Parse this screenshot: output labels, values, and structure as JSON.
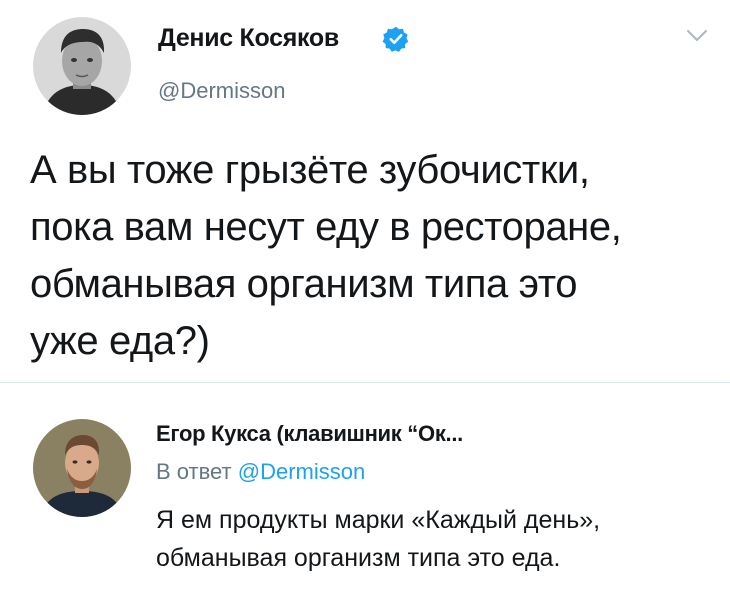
{
  "tweet": {
    "author_name": "Денис Косяков",
    "author_handle": "@Dermisson",
    "text": "А вы тоже грызёте зубочистки,\nпока вам несут еду в ресторане,\nобманывая организм типа это\nуже еда?)",
    "verified": true
  },
  "reply": {
    "author_name": "Егор Кукса (клавишник “Ок...",
    "reply_prefix": "В ответ",
    "reply_handle": "@Dermisson",
    "text": "Я ем продукты марки «Каждый день»,\nобманывая организм типа это еда."
  },
  "colors": {
    "verified_badge": "#1da1f2",
    "link": "#1da1f2",
    "secondary_text": "#657786",
    "divider": "#e1e8ed"
  },
  "icons": {
    "verified": "verified-badge-icon",
    "menu": "chevron-down-icon"
  }
}
